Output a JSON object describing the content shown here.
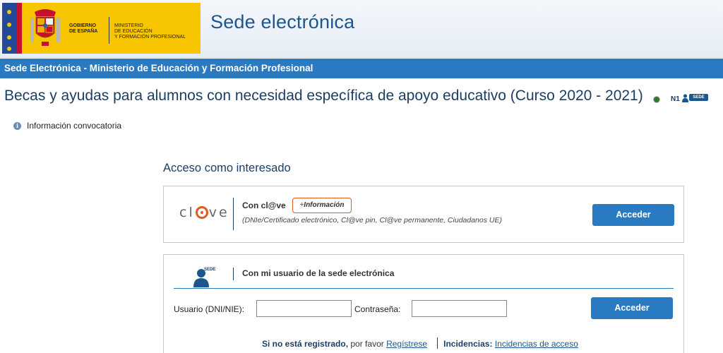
{
  "header": {
    "gov_line1": "GOBIERNO",
    "gov_line2": "DE ESPAÑA",
    "ministry_line1": "MINISTERIO",
    "ministry_line2": "DE EDUCACIÓN",
    "ministry_line3": "Y FORMACIÓN PROFESIONAL",
    "site_title": "Sede electrónica"
  },
  "nav_bar": {
    "title": "Sede Electrónica - Ministerio de Educación y Formación Profesional"
  },
  "page": {
    "title": "Becas y ayudas para alumnos con necesidad específica de apoyo educativo (Curso 2020 - 2021)",
    "level": "N1",
    "sede_badge": "SEDE",
    "info_link": "Información convocatoria"
  },
  "access": {
    "heading": "Acceso como interesado",
    "clave": {
      "logo_left": "cl",
      "logo_right": "ve",
      "title": "Con cl@ve",
      "info_prefix": "+",
      "info_label": "Información",
      "subtitle": "(DNIe/Certificado electrónico, Cl@ve pin, Cl@ve permanente, Ciudadanos UE)",
      "button": "Acceder"
    },
    "sede": {
      "badge": "SEDE",
      "title": "Con mi usuario de la sede electrónica",
      "user_label": "Usuario (DNI/NIE):",
      "user_value": "",
      "password_label": "Contraseña:",
      "password_value": "",
      "button": "Acceder",
      "not_registered": "Si no está registrado,",
      "please": " por favor ",
      "register_link": "Regístrese",
      "incidents_label": "Incidencias:",
      "incidents_link": "Incidencias de acceso"
    }
  },
  "colors": {
    "brand_blue": "#2a7ac1",
    "title_blue": "#1c568f",
    "clave_orange": "#e35a1c",
    "gov_yellow": "#f7c600"
  }
}
